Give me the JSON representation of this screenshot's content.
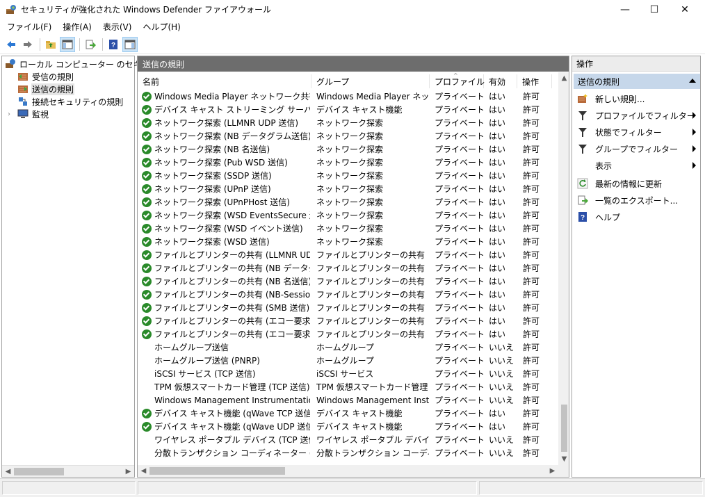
{
  "window": {
    "title": "セキュリティが強化された Windows Defender ファイアウォール",
    "minimize": "—",
    "maximize": "☐",
    "close": "✕"
  },
  "menu": {
    "items": [
      "ファイル(F)",
      "操作(A)",
      "表示(V)",
      "ヘルプ(H)"
    ]
  },
  "toolbar": {
    "icons": [
      "back-arrow-icon",
      "forward-arrow-icon",
      "up-folder-icon",
      "show-hide-tree-icon",
      "export-icon",
      "help-icon",
      "show-hide-action-pane-icon"
    ]
  },
  "tree": {
    "root": "ローカル コンピューター のセキュリティ",
    "items": [
      "受信の規則",
      "送信の規則",
      "接続セキュリティの規則",
      "監視"
    ],
    "selected_index": 1
  },
  "center": {
    "header": "送信の規則",
    "columns": [
      "名前",
      "グループ",
      "プロファイル",
      "有効",
      "操作"
    ],
    "rows": [
      {
        "name": "Windows Media Player ネットワーク共有サー...",
        "group": "Windows Media Player ネット...",
        "profile": "プライベート",
        "enabled": "はい",
        "action": "許可",
        "check": true
      },
      {
        "name": "デバイス キャスト ストリーミング サーバー (RTP ス...",
        "group": "デバイス キャスト機能",
        "profile": "プライベート",
        "enabled": "はい",
        "action": "許可",
        "check": true
      },
      {
        "name": "ネットワーク探索 (LLMNR UDP 送信)",
        "group": "ネットワーク探索",
        "profile": "プライベート",
        "enabled": "はい",
        "action": "許可",
        "check": true
      },
      {
        "name": "ネットワーク探索 (NB データグラム送信)",
        "group": "ネットワーク探索",
        "profile": "プライベート",
        "enabled": "はい",
        "action": "許可",
        "check": true
      },
      {
        "name": "ネットワーク探索 (NB 名送信)",
        "group": "ネットワーク探索",
        "profile": "プライベート",
        "enabled": "はい",
        "action": "許可",
        "check": true
      },
      {
        "name": "ネットワーク探索 (Pub WSD 送信)",
        "group": "ネットワーク探索",
        "profile": "プライベート",
        "enabled": "はい",
        "action": "許可",
        "check": true
      },
      {
        "name": "ネットワーク探索 (SSDP 送信)",
        "group": "ネットワーク探索",
        "profile": "プライベート",
        "enabled": "はい",
        "action": "許可",
        "check": true
      },
      {
        "name": "ネットワーク探索 (UPnP 送信)",
        "group": "ネットワーク探索",
        "profile": "プライベート",
        "enabled": "はい",
        "action": "許可",
        "check": true
      },
      {
        "name": "ネットワーク探索 (UPnPHost 送信)",
        "group": "ネットワーク探索",
        "profile": "プライベート",
        "enabled": "はい",
        "action": "許可",
        "check": true
      },
      {
        "name": "ネットワーク探索 (WSD EventsSecure 送信)",
        "group": "ネットワーク探索",
        "profile": "プライベート",
        "enabled": "はい",
        "action": "許可",
        "check": true
      },
      {
        "name": "ネットワーク探索 (WSD イベント送信)",
        "group": "ネットワーク探索",
        "profile": "プライベート",
        "enabled": "はい",
        "action": "許可",
        "check": true
      },
      {
        "name": "ネットワーク探索 (WSD 送信)",
        "group": "ネットワーク探索",
        "profile": "プライベート",
        "enabled": "はい",
        "action": "許可",
        "check": true
      },
      {
        "name": "ファイルとプリンターの共有 (LLMNR UDP 送信)",
        "group": "ファイルとプリンターの共有",
        "profile": "プライベート",
        "enabled": "はい",
        "action": "許可",
        "check": true
      },
      {
        "name": "ファイルとプリンターの共有 (NB データグラム送信)",
        "group": "ファイルとプリンターの共有",
        "profile": "プライベート",
        "enabled": "はい",
        "action": "許可",
        "check": true
      },
      {
        "name": "ファイルとプリンターの共有 (NB 名送信)",
        "group": "ファイルとプリンターの共有",
        "profile": "プライベート",
        "enabled": "はい",
        "action": "許可",
        "check": true
      },
      {
        "name": "ファイルとプリンターの共有 (NB-Session 送信)",
        "group": "ファイルとプリンターの共有",
        "profile": "プライベート",
        "enabled": "はい",
        "action": "許可",
        "check": true
      },
      {
        "name": "ファイルとプリンターの共有 (SMB 送信)",
        "group": "ファイルとプリンターの共有",
        "profile": "プライベート",
        "enabled": "はい",
        "action": "許可",
        "check": true
      },
      {
        "name": "ファイルとプリンターの共有 (エコー要求 - ICMP...",
        "group": "ファイルとプリンターの共有",
        "profile": "プライベート",
        "enabled": "はい",
        "action": "許可",
        "check": true
      },
      {
        "name": "ファイルとプリンターの共有 (エコー要求 - ICMP...",
        "group": "ファイルとプリンターの共有",
        "profile": "プライベート",
        "enabled": "はい",
        "action": "許可",
        "check": true
      },
      {
        "name": "ホームグループ送信",
        "group": "ホームグループ",
        "profile": "プライベート",
        "enabled": "いいえ",
        "action": "許可",
        "check": false
      },
      {
        "name": "ホームグループ送信 (PNRP)",
        "group": "ホームグループ",
        "profile": "プライベート",
        "enabled": "いいえ",
        "action": "許可",
        "check": false
      },
      {
        "name": "iSCSI サービス (TCP 送信)",
        "group": "iSCSI サービス",
        "profile": "プライベート,...",
        "enabled": "いいえ",
        "action": "許可",
        "check": false
      },
      {
        "name": "TPM 仮想スマートカード管理 (TCP 送信)",
        "group": "TPM 仮想スマートカード管理",
        "profile": "プライベート,...",
        "enabled": "いいえ",
        "action": "許可",
        "check": false
      },
      {
        "name": "Windows Management Instrumentation (...",
        "group": "Windows Management Instr...",
        "profile": "プライベート,...",
        "enabled": "いいえ",
        "action": "許可",
        "check": false
      },
      {
        "name": "デバイス キャスト機能 (qWave TCP 送信)",
        "group": "デバイス キャスト機能",
        "profile": "プライベート,...",
        "enabled": "はい",
        "action": "許可",
        "check": true
      },
      {
        "name": "デバイス キャスト機能 (qWave UDP 送信)",
        "group": "デバイス キャスト機能",
        "profile": "プライベート,...",
        "enabled": "はい",
        "action": "許可",
        "check": true
      },
      {
        "name": "ワイヤレス ポータブル デバイス (TCP 送信)",
        "group": "ワイヤレス ポータブル デバイス",
        "profile": "プライベート,...",
        "enabled": "いいえ",
        "action": "許可",
        "check": false
      },
      {
        "name": "分散トランザクション コーディネーター (TCP 送信)",
        "group": "分散トランザクション コーディネー",
        "profile": "プライベート,...",
        "enabled": "いいえ",
        "action": "許可",
        "check": false
      }
    ]
  },
  "actions": {
    "header": "操作",
    "section": "送信の規則",
    "items": [
      {
        "label": "新しい規則...",
        "icon": "new-rule-icon",
        "submenu": false
      },
      {
        "label": "プロファイルでフィルター",
        "icon": "filter-icon",
        "submenu": true
      },
      {
        "label": "状態でフィルター",
        "icon": "filter-icon",
        "submenu": true
      },
      {
        "label": "グループでフィルター",
        "icon": "filter-icon",
        "submenu": true
      },
      {
        "label": "表示",
        "icon": "",
        "submenu": true
      },
      {
        "label": "最新の情報に更新",
        "icon": "refresh-icon",
        "submenu": false
      },
      {
        "label": "一覧のエクスポート...",
        "icon": "export-list-icon",
        "submenu": false
      },
      {
        "label": "ヘルプ",
        "icon": "help-icon",
        "submenu": false
      }
    ]
  },
  "colors": {
    "center_header_bg": "#6d6d6d",
    "section_bg": "#c6d7ea",
    "check_green": "#2a8a2a"
  }
}
